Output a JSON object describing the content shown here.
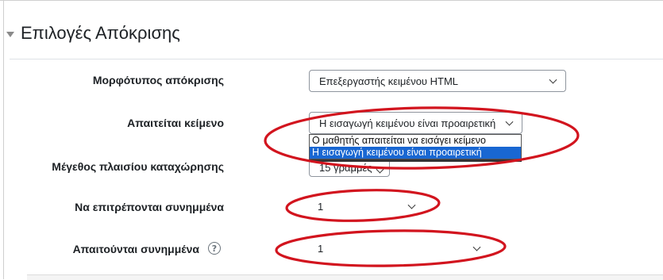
{
  "section": {
    "title": "Επιλογές Απόκρισης"
  },
  "fields": {
    "response_format": {
      "label": "Μορφότυπος απόκρισης",
      "value": "Επεξεργαστής κειμένου HTML"
    },
    "require_text": {
      "label": "Απαιτείται κείμενο",
      "value": "Η εισαγωγή κειμένου είναι προαιρετική",
      "options": [
        "Ο μαθητής απαιτείται να εισάγει κείμενο",
        "Η εισαγωγή κειμένου είναι προαιρετική"
      ]
    },
    "input_box_size": {
      "label": "Μέγεθος πλαισίου καταχώρησης",
      "value": "15 γραμμές"
    },
    "allow_attachments": {
      "label": "Να επιτρέπονται συνημμένα",
      "value": "1"
    },
    "required_attachments": {
      "label": "Απαιτούνται συνημμένα",
      "value": "1",
      "help_icon": "question-circle-icon"
    }
  },
  "annotation_color": "#d2141e"
}
